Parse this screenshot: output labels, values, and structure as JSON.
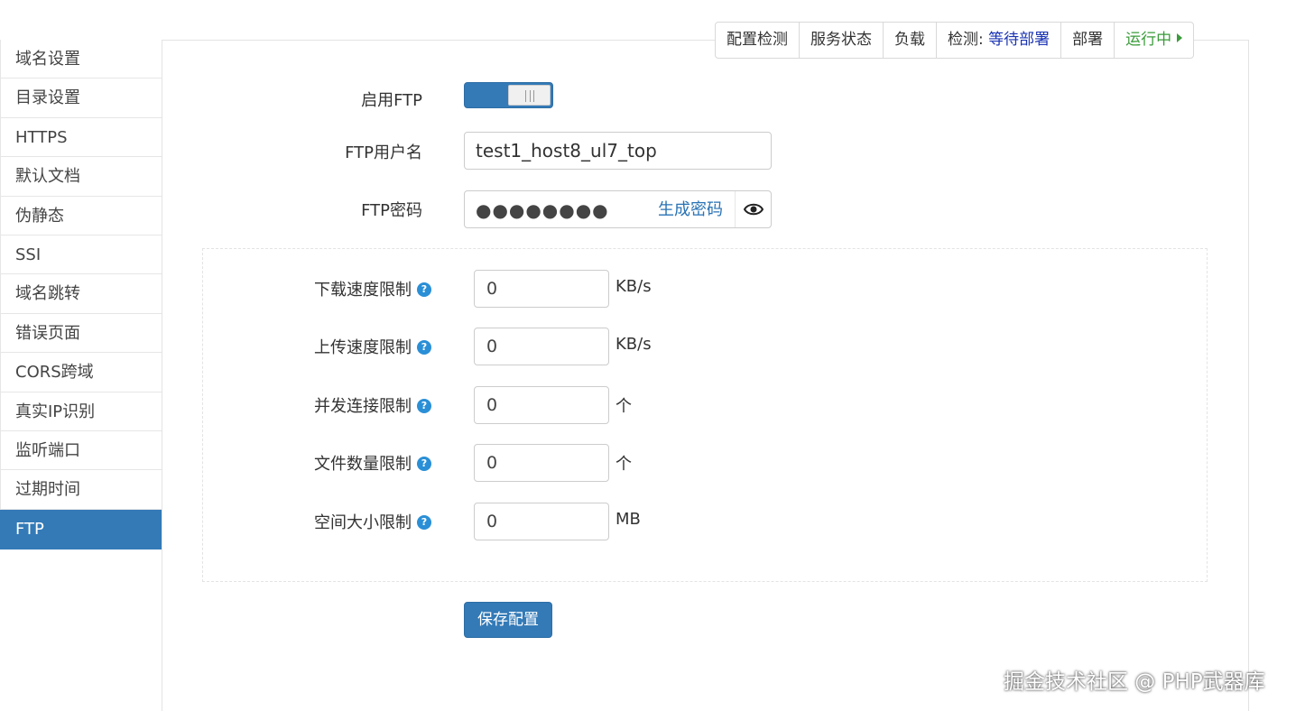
{
  "toolbar": {
    "config_check": "配置检测",
    "service_status": "服务状态",
    "load": "负载",
    "detect_label": "检测:",
    "detect_status": "等待部署",
    "deploy": "部署",
    "running": "运行中"
  },
  "sidebar": {
    "items": [
      {
        "label": "域名设置"
      },
      {
        "label": "目录设置"
      },
      {
        "label": "HTTPS"
      },
      {
        "label": "默认文档"
      },
      {
        "label": "伪静态"
      },
      {
        "label": "SSI"
      },
      {
        "label": "域名跳转"
      },
      {
        "label": "错误页面"
      },
      {
        "label": "CORS跨域"
      },
      {
        "label": "真实IP识别"
      },
      {
        "label": "监听端口"
      },
      {
        "label": "过期时间"
      },
      {
        "label": "FTP"
      }
    ],
    "active": "FTP"
  },
  "form": {
    "enable_ftp_label": "启用FTP",
    "enable_ftp_on": true,
    "username_label": "FTP用户名",
    "username_value": "test1_host8_ul7_top",
    "password_label": "FTP密码",
    "password_masked": "●●●●●●●●",
    "generate_password": "生成密码",
    "eye_icon": "eye-icon"
  },
  "limits": {
    "download": {
      "label": "下载速度限制",
      "value": "0",
      "unit": "KB/s"
    },
    "upload": {
      "label": "上传速度限制",
      "value": "0",
      "unit": "KB/s"
    },
    "connections": {
      "label": "并发连接限制",
      "value": "0",
      "unit": "个"
    },
    "files": {
      "label": "文件数量限制",
      "value": "0",
      "unit": "个"
    },
    "space": {
      "label": "空间大小限制",
      "value": "0",
      "unit": "MB"
    },
    "help_glyph": "?"
  },
  "save_button": "保存配置",
  "watermark": "掘金技术社区 @ PHP武器库",
  "colors": {
    "primary": "#337ab7",
    "link": "#2a73b5",
    "running": "#3a9b3a",
    "status": "#1a33b3",
    "help": "#2a8fd6"
  }
}
